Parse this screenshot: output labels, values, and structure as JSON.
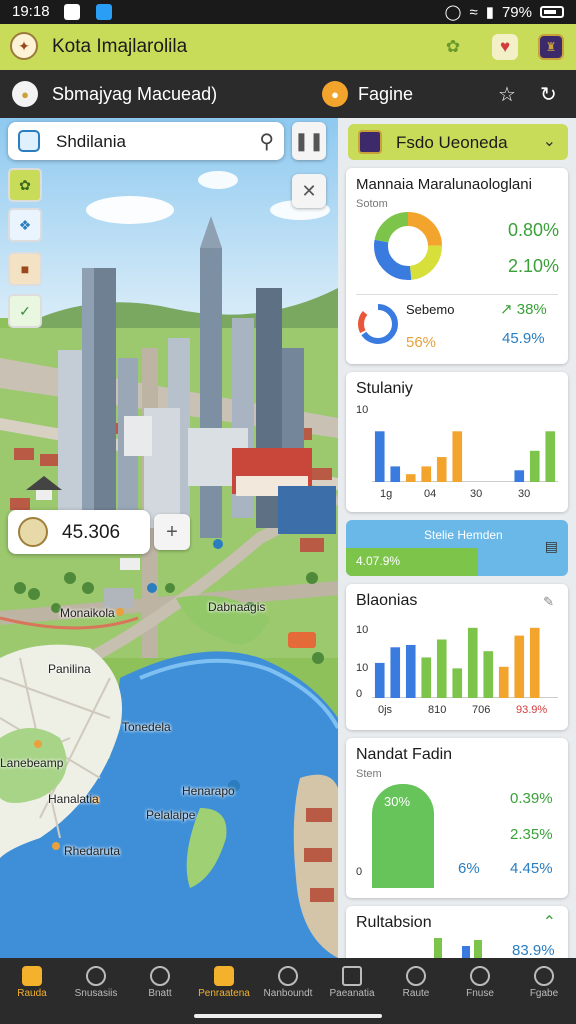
{
  "status": {
    "time": "19:18",
    "battery": "79%"
  },
  "appbar": {
    "title": "Kota Imajlarolila"
  },
  "subbar": {
    "left_label": "Sbmajyag Macuead)",
    "right_label": "Fagine"
  },
  "map": {
    "search_text": "Shdilania",
    "metric_value": "45.306",
    "labels": [
      "Monaikola",
      "Dabnaagis",
      "Panilina",
      "Tonedela",
      "Lanebeamp",
      "Hanalatia",
      "Pelalaipe",
      "Rhedaruta",
      "Henarapo"
    ]
  },
  "panel": {
    "dropdown_label": "Fsdo Ueoneda",
    "card1": {
      "title": "Mannaia Maralunaologlani",
      "subtitle": "Sotom",
      "v1": "0.80%",
      "v2": "2.10%",
      "sub_label": "Sebemo",
      "v3": "↗ 38%",
      "v4": "45.9%",
      "v5": "56%"
    },
    "card2": {
      "title": "Stulaniy",
      "y_tick": "10",
      "x_ticks": [
        "1g",
        "04",
        "30",
        "30"
      ],
      "chart_data": {
        "type": "bar",
        "ylim": [
          0,
          10
        ],
        "series": [
          {
            "color": "#3a7be0",
            "values": [
              6.5,
              2,
              0,
              1,
              0,
              0,
              0,
              0,
              0,
              1.5,
              0,
              0
            ]
          },
          {
            "color": "#f3a42c",
            "values": [
              0,
              0,
              1,
              2,
              3.2,
              6.5,
              0,
              0,
              0,
              0,
              0,
              0
            ]
          },
          {
            "color": "#7cc44a",
            "values": [
              0,
              0,
              0,
              0,
              0,
              0,
              0,
              0,
              0,
              0,
              4,
              6.5
            ]
          }
        ]
      }
    },
    "banner": {
      "label": "Stelie Hemden",
      "value": "4.07.9%"
    },
    "card3": {
      "title": "Blaonias",
      "y_ticks": [
        "10",
        "10",
        "0"
      ],
      "x_ticks": [
        "0js",
        "810",
        "706",
        "93.9%"
      ],
      "chart_data": {
        "type": "bar",
        "ylim": [
          0,
          10
        ],
        "series": [
          {
            "color": "#3a7be0",
            "values": [
              4.5,
              6.5,
              6.8,
              0,
              0,
              0,
              0,
              0,
              0,
              0,
              0,
              0
            ]
          },
          {
            "color": "#7cc44a",
            "values": [
              0,
              0,
              0,
              5.2,
              7.5,
              3.8,
              9.0,
              6.0,
              0,
              0,
              0,
              0
            ]
          },
          {
            "color": "#f3a42c",
            "values": [
              0,
              0,
              0,
              0,
              0,
              0,
              0,
              0,
              4.0,
              8.0,
              9.0,
              0
            ]
          }
        ]
      }
    },
    "card4": {
      "title": "Nandat Fadin",
      "subtitle": "Stem",
      "bar_value": "30%",
      "zero": "0",
      "v1": "0.39%",
      "v2": "2.35%",
      "v3": "6%",
      "v4": "4.45%"
    },
    "card5": {
      "title": "Rultabsion",
      "v1": "83.9%"
    }
  },
  "nav": [
    {
      "label": "Rauda"
    },
    {
      "label": "Snusasiis"
    },
    {
      "label": "Bnatt"
    },
    {
      "label": "Penraatena"
    },
    {
      "label": "Nanboundt"
    },
    {
      "label": "Paeanatia"
    },
    {
      "label": "Raute"
    },
    {
      "label": "Fnuse"
    },
    {
      "label": "Fgabe"
    }
  ]
}
